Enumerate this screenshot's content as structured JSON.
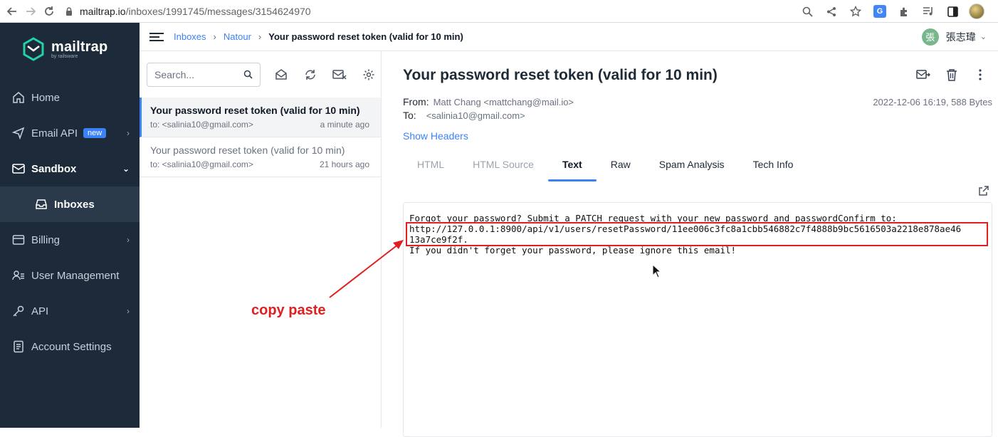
{
  "browser": {
    "url_host": "mailtrap.io",
    "url_path": "/inboxes/1991745/messages/3154624970",
    "icons": [
      "back-icon",
      "forward-icon",
      "reload-icon",
      "zoom-icon",
      "share-icon",
      "bookmark-star-icon",
      "translate-icon",
      "extensions-icon",
      "media-icon",
      "sidebar-icon",
      "profile-avatar"
    ]
  },
  "logo": {
    "name": "mailtrap",
    "sub": "by railsware"
  },
  "sidebar": {
    "items": [
      {
        "label": "Home",
        "icon": "home-icon"
      },
      {
        "label": "Email API",
        "icon": "send-icon",
        "badge": "new"
      },
      {
        "label": "Sandbox",
        "icon": "sandbox-icon"
      },
      {
        "label": "Inboxes",
        "icon": "inbox-icon"
      },
      {
        "label": "Billing",
        "icon": "billing-icon"
      },
      {
        "label": "User Management",
        "icon": "users-icon"
      },
      {
        "label": "API",
        "icon": "api-icon"
      },
      {
        "label": "Account Settings",
        "icon": "settings-doc-icon"
      }
    ]
  },
  "header": {
    "crumbs": [
      "Inboxes",
      "Natour",
      "Your password reset token (valid for 10 min)"
    ],
    "user_initial": "張",
    "user_name": "張志瑋"
  },
  "list": {
    "search_placeholder": "Search...",
    "messages": [
      {
        "subject": "Your password reset token (valid for 10 min)",
        "to": "to: <salinia10@gmail.com>",
        "time": "a minute ago"
      },
      {
        "subject": "Your password reset token (valid for 10 min)",
        "to": "to: <salinia10@gmail.com>",
        "time": "21 hours ago"
      }
    ]
  },
  "view": {
    "subject": "Your password reset token (valid for 10 min)",
    "from_label": "From:",
    "from_value": "Matt Chang <mattchang@mail.io>",
    "to_label": "To:",
    "to_value": "<salinia10@gmail.com>",
    "date_size": "2022-12-06 16:19, 588 Bytes",
    "show_headers": "Show Headers",
    "tabs": [
      "HTML",
      "HTML Source",
      "Text",
      "Raw",
      "Spam Analysis",
      "Tech Info"
    ],
    "selected_tab": "Text",
    "body_lines": [
      "Forgot your password? Submit a PATCH request with your new password and passwordConfirm to:",
      "http://127.0.0.1:8900/api/v1/users/resetPassword/11ee006c3fc8a1cbb546882c7f4888b9bc5616503a2218e878ae46",
      "13a7ce9f2f.",
      "If you didn't forget your password, please ignore this email!"
    ]
  },
  "annotation": {
    "text": "copy paste",
    "color": "#e02020"
  },
  "colors": {
    "sidebar_bg": "#1c2a3a",
    "accent": "#3b82f6",
    "highlight": "#e02020"
  }
}
